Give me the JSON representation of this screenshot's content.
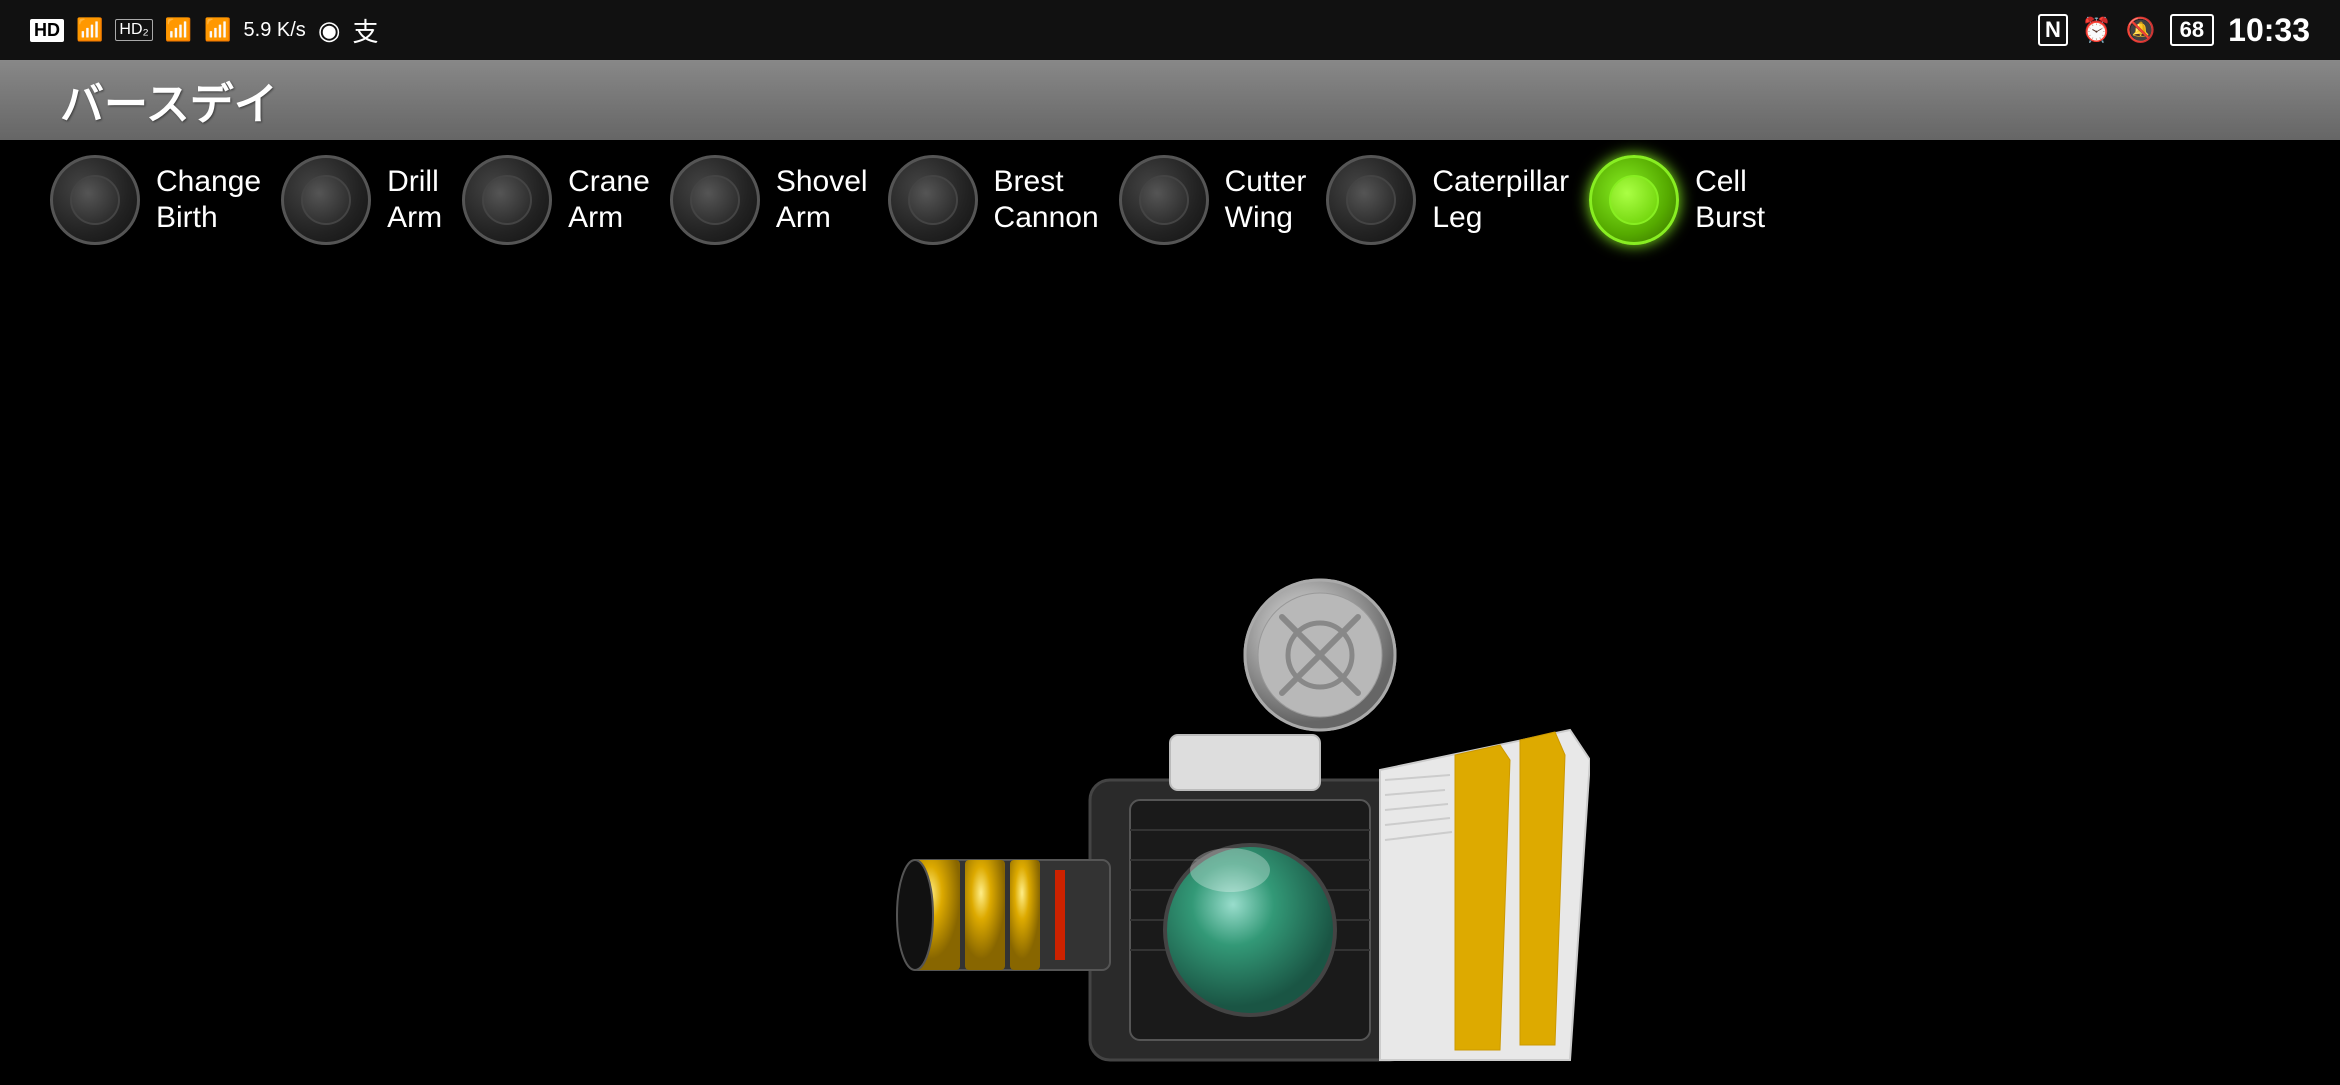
{
  "statusBar": {
    "left": {
      "hdBadge1": "HD",
      "hdBadge2": "HD₂",
      "signal4g1": "4G",
      "signal4g2": "4G",
      "wifi": "WiFi",
      "speed": "5.9\nK/s",
      "navIcon": "◉",
      "alipayIcon": "支"
    },
    "right": {
      "nfcIcon": "N",
      "alarmIcon": "⏰",
      "muteIcon": "🔕",
      "battery": "68",
      "time": "10:33"
    }
  },
  "titleBar": {
    "text": "バースデイ"
  },
  "buttons": [
    {
      "id": "change-birth",
      "label": "Change\nBirth",
      "active": false
    },
    {
      "id": "drill-arm",
      "label": "Drill\nArm",
      "active": false
    },
    {
      "id": "crane-arm",
      "label": "Crane\nArm",
      "active": false
    },
    {
      "id": "shovel-arm",
      "label": "Shovel\nArm",
      "active": false
    },
    {
      "id": "brest-cannon",
      "label": "Brest\nCannon",
      "active": false
    },
    {
      "id": "cutter-wing",
      "label": "Cutter\nWing",
      "active": false
    },
    {
      "id": "caterpillar-leg",
      "label": "Caterpillar\nLeg",
      "active": false
    },
    {
      "id": "cell-burst",
      "label": "Cell\nBurst",
      "active": true
    }
  ],
  "colors": {
    "activeGreen": "#88ee22",
    "inactiveGray": "#333",
    "titleBg": "#777",
    "statusBg": "#111"
  }
}
